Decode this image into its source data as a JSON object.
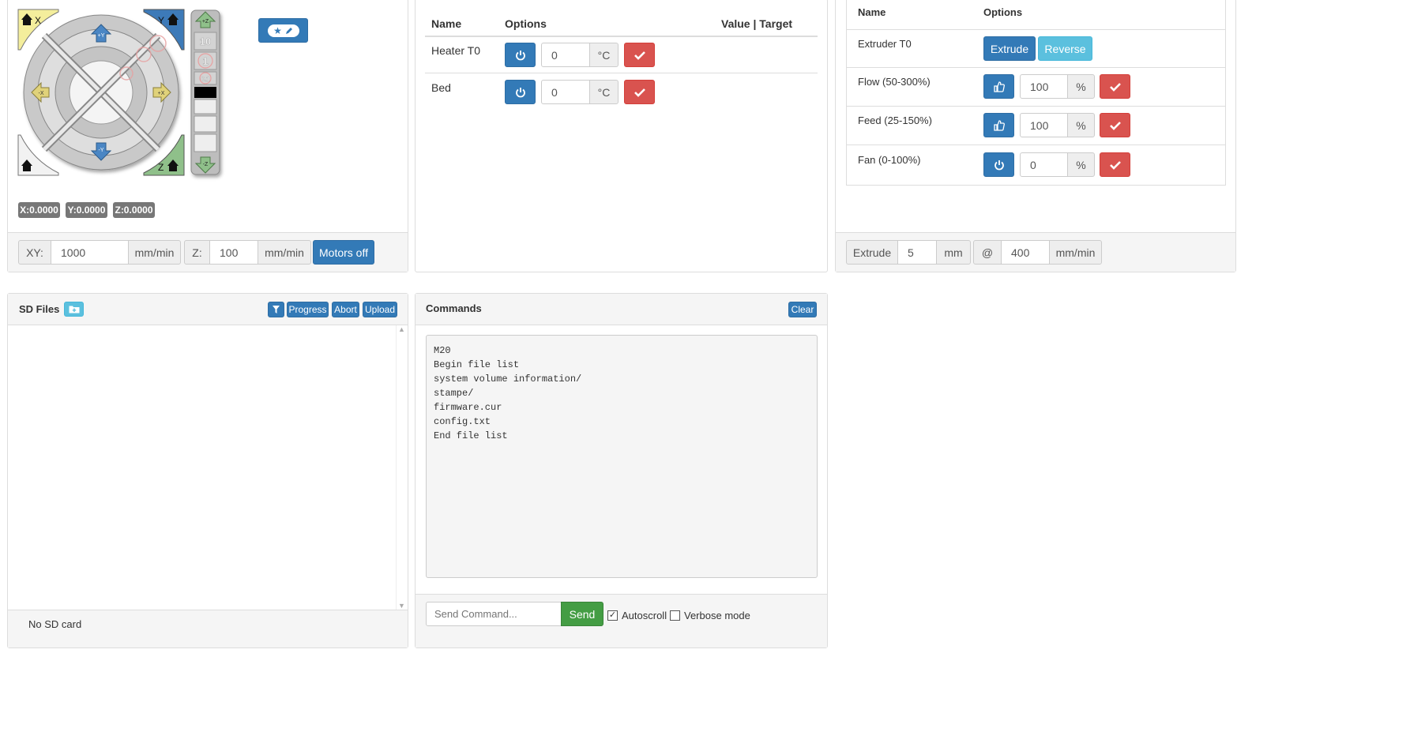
{
  "jog": {
    "corner_labels": {
      "home_x": "X",
      "home_y": "Y",
      "home_z": "Z"
    },
    "arrow_labels": {
      "y_plus": "+Y",
      "y_minus": "-Y",
      "x_plus": "+X",
      "x_minus": "-X",
      "z_plus": "+Z",
      "z_minus": "-Z"
    },
    "z_steps": [
      "10",
      "1",
      "0.1"
    ],
    "ring_steps": [
      "10",
      "1",
      "0.1"
    ],
    "position": {
      "x": "X:0.0000",
      "y": "Y:0.0000",
      "z": "Z:0.0000"
    },
    "edit_button_icon": "star-pencil-icon"
  },
  "feedrates": {
    "xy_label": "XY:",
    "xy_value": "1000",
    "xy_unit": "mm/min",
    "z_label": "Z:",
    "z_value": "100",
    "z_unit": "mm/min",
    "motors_off": "Motors off"
  },
  "temperatures": {
    "headers": {
      "name": "Name",
      "options": "Options",
      "value_target": "Value | Target"
    },
    "rows": [
      {
        "name": "Heater T0",
        "value": "0",
        "unit": "°C"
      },
      {
        "name": "Bed",
        "value": "0",
        "unit": "°C"
      }
    ]
  },
  "extruder": {
    "headers": {
      "name": "Name",
      "options": "Options"
    },
    "extruder_row": {
      "name": "Extruder T0",
      "extrude": "Extrude",
      "reverse": "Reverse"
    },
    "rows": [
      {
        "name": "Flow (50-300%)",
        "value": "100",
        "unit": "%"
      },
      {
        "name": "Feed (25-150%)",
        "value": "100",
        "unit": "%"
      },
      {
        "name": "Fan (0-100%)",
        "value": "0",
        "unit": "%"
      }
    ],
    "footer": {
      "extrude_label": "Extrude",
      "extrude_value": "5",
      "extrude_unit": "mm",
      "at": "@",
      "speed_value": "400",
      "speed_unit": "mm/min"
    }
  },
  "sd_files": {
    "title": "SD Files",
    "buttons": {
      "progress": "Progress",
      "abort": "Abort",
      "upload": "Upload"
    },
    "status": "No SD card"
  },
  "commands": {
    "title": "Commands",
    "clear": "Clear",
    "log": [
      "M20",
      "Begin file list",
      "system volume information/",
      "stampe/",
      "firmware.cur",
      "config.txt",
      "End file list"
    ],
    "input_placeholder": "Send Command...",
    "send": "Send",
    "autoscroll": "Autoscroll",
    "autoscroll_checked": true,
    "verbose": "Verbose mode",
    "verbose_checked": false
  },
  "colors": {
    "primary": "#337ab7",
    "info": "#5bc0de",
    "danger": "#d9534f",
    "success": "#449d44",
    "home_x": "#f4ee9c",
    "home_y": "#3d7ab8",
    "home_z": "#8fc08a"
  }
}
